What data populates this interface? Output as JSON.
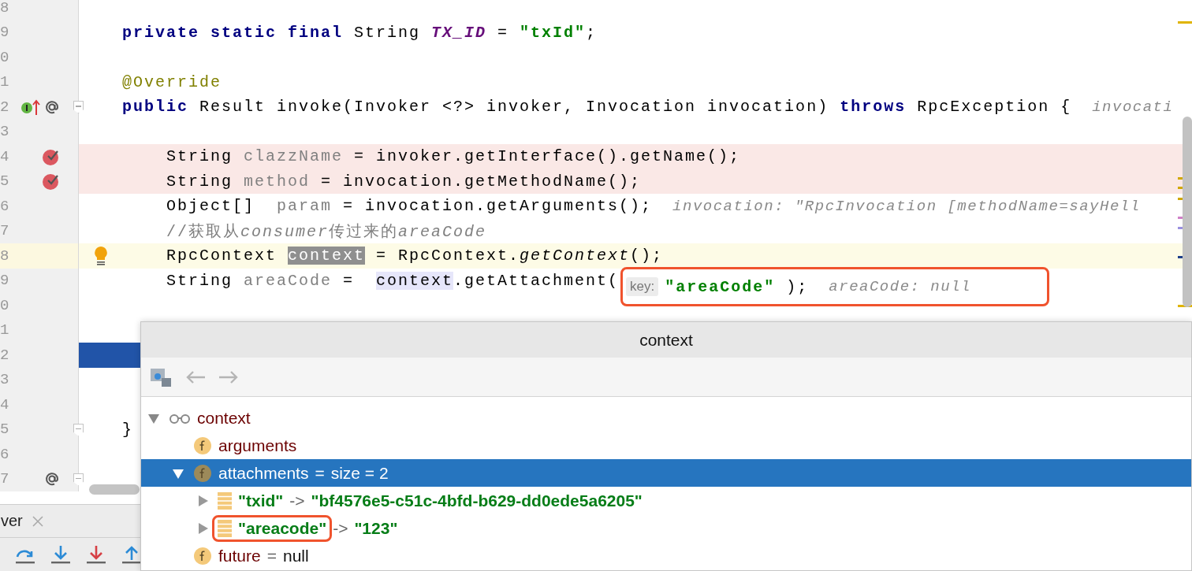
{
  "editor": {
    "lines": [
      {
        "number": "8",
        "kind": "declaration"
      },
      {
        "number": "9",
        "kind": "declaration",
        "parts": [
          {
            "kind": "code",
            "tokens": [
              {
                "kind": "keyword",
                "text": "private static final"
              },
              {
                "kind": "plain",
                "text": " String "
              },
              {
                "kind": "static-field",
                "text": "TX_ID"
              },
              {
                "kind": "plain",
                "text": " = "
              },
              {
                "kind": "string",
                "text": "\"txId\""
              },
              {
                "kind": "plain",
                "text": ";"
              }
            ]
          }
        ]
      },
      {
        "number": "0",
        "kind": "declaration"
      },
      {
        "number": "1",
        "kind": "declaration",
        "parts": [
          {
            "kind": "code",
            "tokens": [
              {
                "kind": "annotation",
                "text": "@Override"
              }
            ]
          }
        ]
      },
      {
        "number": "2",
        "kind": "declaration",
        "gutter_icons": [
          {
            "kind": "implements"
          },
          {
            "kind": "override"
          }
        ],
        "fold": true,
        "parts": [
          {
            "kind": "code",
            "tokens": [
              {
                "kind": "keyword",
                "text": "public"
              },
              {
                "kind": "plain",
                "text": " Result invoke(Invoker <?> invoker, Invocation invocation) "
              },
              {
                "kind": "keyword",
                "text": "throws"
              },
              {
                "kind": "plain",
                "text": " RpcException {"
              }
            ]
          },
          {
            "kind": "value-hint",
            "text": "invocati"
          }
        ]
      },
      {
        "number": "3",
        "kind": "statement"
      },
      {
        "number": "4",
        "kind": "statement",
        "breakpoint": true,
        "gutter_icons": [
          {
            "kind": "breakpoint"
          }
        ],
        "parts": [
          {
            "kind": "code",
            "tokens": [
              {
                "kind": "plain",
                "text": "String "
              },
              {
                "kind": "unused",
                "text": "clazzName"
              },
              {
                "kind": "plain",
                "text": " = invoker.getInterface().getName();"
              }
            ]
          }
        ]
      },
      {
        "number": "5",
        "kind": "statement",
        "breakpoint": true,
        "gutter_icons": [
          {
            "kind": "breakpoint"
          }
        ],
        "parts": [
          {
            "kind": "code",
            "tokens": [
              {
                "kind": "plain",
                "text": "String "
              },
              {
                "kind": "unused",
                "text": "method"
              },
              {
                "kind": "plain",
                "text": " = invocation.getMethodName();"
              }
            ]
          }
        ]
      },
      {
        "number": "6",
        "kind": "statement",
        "parts": [
          {
            "kind": "code",
            "tokens": [
              {
                "kind": "plain",
                "text": "Object[]  "
              },
              {
                "kind": "unused",
                "text": "param"
              },
              {
                "kind": "plain",
                "text": " = invocation.getArguments();"
              }
            ]
          },
          {
            "kind": "value-hint",
            "text": "invocation: \"RpcInvocation [methodName=sayHell"
          }
        ]
      },
      {
        "number": "7",
        "kind": "statement",
        "parts": [
          {
            "kind": "code",
            "tokens": [
              {
                "kind": "comment",
                "text": "//获取从"
              },
              {
                "kind": "comment-italic",
                "text": "consumer"
              },
              {
                "kind": "comment",
                "text": "传过来的"
              },
              {
                "kind": "comment-italic",
                "text": "areaCode"
              }
            ]
          }
        ]
      },
      {
        "number": "8",
        "kind": "statement",
        "caret_line": true,
        "intention_bulb": true,
        "parts": [
          {
            "kind": "code",
            "tokens": [
              {
                "kind": "plain",
                "text": "RpcContext "
              },
              {
                "kind": "selected-var",
                "text": "context"
              },
              {
                "kind": "plain",
                "text": " = RpcContext."
              },
              {
                "kind": "method-italic",
                "text": "getContext"
              },
              {
                "kind": "plain",
                "text": "();"
              }
            ]
          }
        ]
      },
      {
        "number": "9",
        "kind": "statement",
        "parts": [
          {
            "kind": "code",
            "tokens": [
              {
                "kind": "plain",
                "text": "String "
              },
              {
                "kind": "unused",
                "text": "areaCode"
              },
              {
                "kind": "plain",
                "text": " =  "
              },
              {
                "kind": "usage",
                "text": "context"
              },
              {
                "kind": "plain",
                "text": ".getAttachment("
              }
            ]
          },
          {
            "kind": "param-hint",
            "text": "key:",
            "framed": true
          },
          {
            "kind": "code",
            "framed": true,
            "tokens": [
              {
                "kind": "string",
                "text": "\"areaCode\""
              },
              {
                "kind": "plain",
                "text": " );"
              }
            ]
          },
          {
            "kind": "value-hint",
            "text": "areaCode: null",
            "framed": true
          }
        ]
      },
      {
        "number": "0",
        "kind": "statement"
      },
      {
        "number": "1",
        "kind": "statement"
      },
      {
        "number": "2",
        "kind": "statement",
        "execution_line": true
      },
      {
        "number": "3",
        "kind": "statement"
      },
      {
        "number": "4",
        "kind": "statement"
      },
      {
        "number": "5",
        "kind": "declaration",
        "fold": true,
        "parts": [
          {
            "kind": "code",
            "tokens": [
              {
                "kind": "plain",
                "text": "}"
              }
            ]
          }
        ]
      },
      {
        "number": "6",
        "kind": "declaration"
      },
      {
        "number": "7",
        "kind": "declaration",
        "gutter_icons": [
          {
            "kind": "override"
          }
        ],
        "fold": true
      }
    ]
  },
  "bottom_panel": {
    "tab": {
      "label": "ver"
    },
    "toolbar": [
      {
        "kind": "step-over"
      },
      {
        "kind": "step-into"
      },
      {
        "kind": "force-step-into"
      },
      {
        "kind": "step-out"
      }
    ]
  },
  "popup": {
    "title": "context",
    "tree": [
      {
        "name": "context",
        "kind": "watch",
        "expanded": true,
        "selected": false,
        "children": [
          {
            "name": "arguments",
            "kind": "field",
            "selected": false
          },
          {
            "name": "attachments",
            "separator": "=",
            "value": "size = 2",
            "kind": "field",
            "expanded": true,
            "selected": true,
            "children": [
              {
                "name": "\"txid\"",
                "separator": "->",
                "value": "\"bf4576e5-c51c-4bfd-b629-dd0ede5a6205\"",
                "kind": "entry",
                "expanded": false,
                "selected": false
              },
              {
                "name": "\"areacode\"",
                "separator": "->",
                "value": "\"123\"",
                "kind": "entry",
                "expanded": false,
                "selected": false,
                "framed": true
              }
            ]
          },
          {
            "name": "future",
            "separator": "=",
            "value": "null",
            "kind": "field",
            "selected": false
          }
        ]
      }
    ]
  }
}
